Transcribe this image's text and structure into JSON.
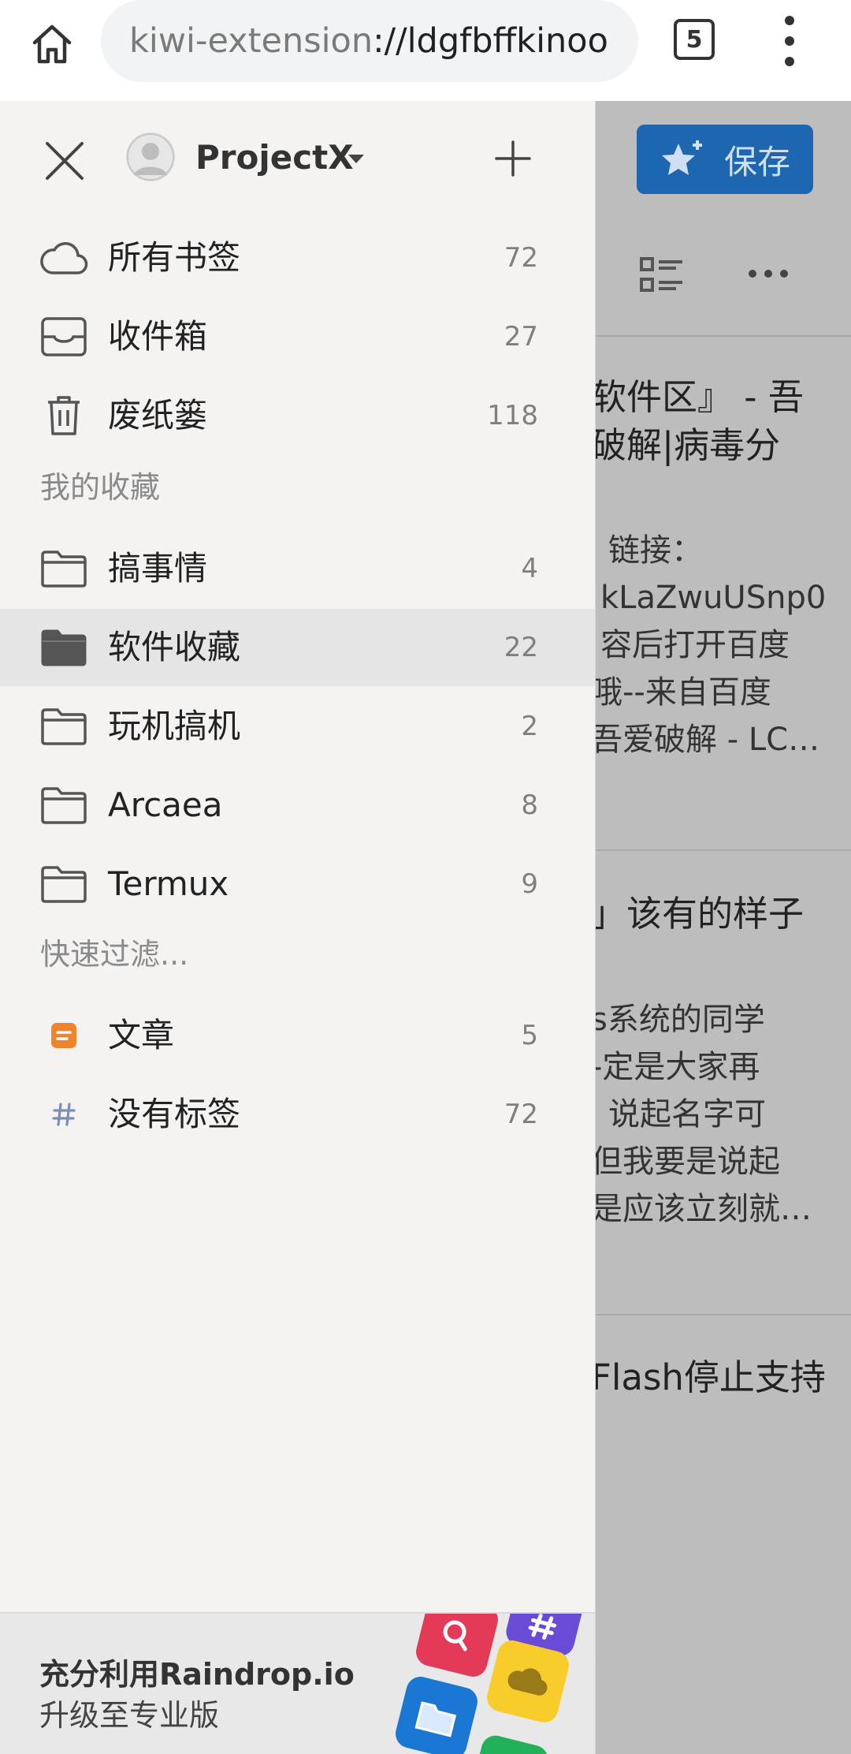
{
  "browser": {
    "url_scheme": "kiwi-extension",
    "url_rest": "://ldgfbffkinoo",
    "tab_count": "5",
    "icons": {
      "home": "home-icon",
      "menu": "more-vert-icon"
    }
  },
  "background_page": {
    "save_label": "保存",
    "lines": [
      "软件区』 - 吾",
      "破解|病毒分",
      "链接：",
      "kLaZwuUSnp0",
      "容后打开百度",
      "哦--来自百度",
      "吾爱破解 - LC…",
      "」该有的样子",
      "s系统的同学",
      "-定是大家再",
      "说起名字可",
      "但我要是说起",
      "是应该立刻就…",
      "Flash停止支持"
    ]
  },
  "drawer": {
    "account_name": "ProjectX",
    "system_items": [
      {
        "label": "所有书签",
        "count": "72",
        "icon": "cloud-icon"
      },
      {
        "label": "收件箱",
        "count": "27",
        "icon": "inbox-icon"
      },
      {
        "label": "废纸篓",
        "count": "118",
        "icon": "trash-icon"
      }
    ],
    "section_favorites": "我的收藏",
    "collections": [
      {
        "label": "搞事情",
        "count": "4",
        "icon": "folder-icon",
        "selected": false
      },
      {
        "label": "软件收藏",
        "count": "22",
        "icon": "folder-filled-icon",
        "selected": true
      },
      {
        "label": "玩机搞机",
        "count": "2",
        "icon": "folder-icon",
        "selected": false
      },
      {
        "label": "Arcaea",
        "count": "8",
        "icon": "folder-icon",
        "selected": false
      },
      {
        "label": "Termux",
        "count": "9",
        "icon": "folder-icon",
        "selected": false
      }
    ],
    "section_filters": "快速过滤...",
    "filters": [
      {
        "label": "文章",
        "count": "5",
        "icon": "article-icon"
      },
      {
        "label": "没有标签",
        "count": "72",
        "icon": "hashtag-icon"
      }
    ],
    "promo": {
      "title": "充分利用Raindrop.io",
      "subtitle": "升级至专业版"
    }
  },
  "colors": {
    "save_button": "#1e66b0",
    "selected_row": "#e5e5e5",
    "drawer_bg": "#f4f3f2",
    "article_icon": "#f0842c",
    "hashtag_icon": "#7b8fb5"
  }
}
